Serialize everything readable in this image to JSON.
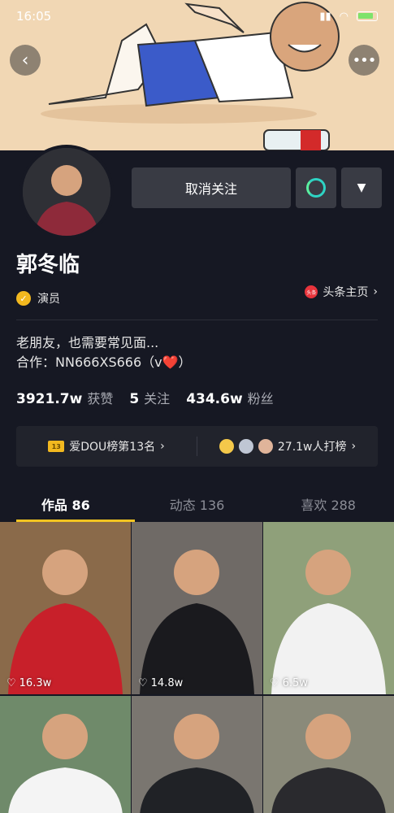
{
  "statusbar": {
    "time": "16:05"
  },
  "profile": {
    "follow_label": "取消关注",
    "name": "郭冬临",
    "role": "演员",
    "toutiao_label": "头条主页",
    "toutiao_logo": "头条",
    "bio_line1": "老朋友，也需要常见面...",
    "bio_line2": "合作：NN666XS666（v❤️）"
  },
  "stats": [
    {
      "value": "3921.7w",
      "label": "获赞"
    },
    {
      "value": "5",
      "label": "关注"
    },
    {
      "value": "434.6w",
      "label": "粉丝"
    }
  ],
  "rank": {
    "left_badge": "13",
    "left_text": "爱DOU榜第13名",
    "right_text": "27.1w人打榜"
  },
  "tabs": [
    {
      "label": "作品 86",
      "active": true
    },
    {
      "label": "动态 136",
      "active": false
    },
    {
      "label": "喜欢 288",
      "active": false
    }
  ],
  "videos": [
    {
      "likes": "16.3w",
      "shirt": "#c8202a",
      "bg": "#8a6a4a"
    },
    {
      "likes": "14.8w",
      "shirt": "#1a1a1e",
      "bg": "#6f6a66"
    },
    {
      "likes": "6.5w",
      "shirt": "#f2f2f2",
      "bg": "#8fa07a"
    },
    {
      "likes": "",
      "shirt": "#f4f4f4",
      "bg": "#6f8a6a"
    },
    {
      "likes": "",
      "shirt": "#202226",
      "bg": "#7a7670"
    },
    {
      "likes": "",
      "shirt": "#2a2a2e",
      "bg": "#8a8a7a"
    }
  ],
  "colors": {
    "background": "#161823",
    "accent": "#f2c421",
    "button": "#393b44"
  },
  "icons": {
    "back": "chevron-left-icon",
    "more": "more-dots-icon",
    "message": "message-ring-icon",
    "dropdown": "triangle-down-icon",
    "verified": "verified-badge-icon",
    "like": "heart-outline-icon"
  }
}
